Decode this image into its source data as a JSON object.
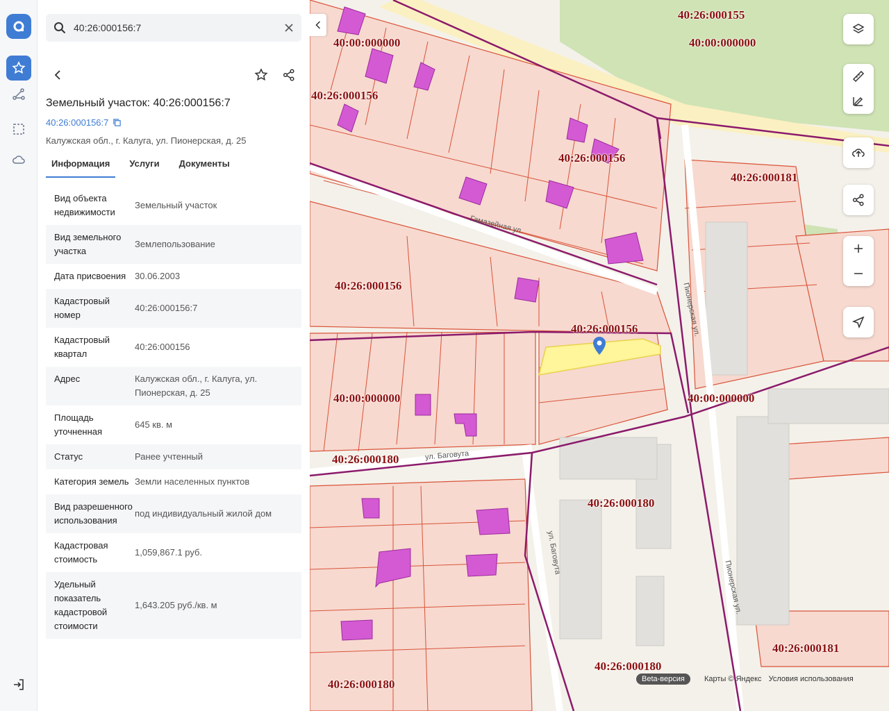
{
  "search": {
    "value": "40:26:000156:7"
  },
  "object": {
    "title": "Земельный участок: 40:26:000156:7",
    "cad_link": "40:26:000156:7",
    "address": "Калужская обл., г. Калуга, ул. Пионерская, д. 25"
  },
  "tabs": [
    "Информация",
    "Услуги",
    "Документы"
  ],
  "info": [
    {
      "k": "Вид объекта недвижимости",
      "v": "Земельный участок"
    },
    {
      "k": "Вид земельного участка",
      "v": "Землепользование"
    },
    {
      "k": "Дата присвоения",
      "v": "30.06.2003"
    },
    {
      "k": "Кадастровый номер",
      "v": "40:26:000156:7"
    },
    {
      "k": "Кадастровый квартал",
      "v": "40:26:000156"
    },
    {
      "k": "Адрес",
      "v": "Калужская обл., г. Калуга, ул. Пионерская, д. 25"
    },
    {
      "k": "Площадь уточненная",
      "v": "645 кв. м"
    },
    {
      "k": "Статус",
      "v": "Ранее учтенный"
    },
    {
      "k": "Категория земель",
      "v": "Земли населенных пунктов"
    },
    {
      "k": "Вид разрешенного использования",
      "v": "под индивидуальный жилой дом"
    },
    {
      "k": "Кадастровая стоимость",
      "v": "1,059,867.1 руб."
    },
    {
      "k": "Удельный показатель кадастровой стоимости",
      "v": "1,643.205 руб./кв. м"
    }
  ],
  "map": {
    "quarter_labels": [
      "40:26:000155",
      "40:00:000000",
      "40:00:000000",
      "40:26:000156",
      "40:26:000156",
      "40:26:000181",
      "40:26:000156",
      "40:26:000156",
      "40:00:000000",
      "40:00:000000",
      "40:26:000180",
      "40:26:000180",
      "40:26:000180",
      "40:26:000181",
      "40:26:000180"
    ],
    "streets": [
      "Гамазейная ул.",
      "Пионерская ул.",
      "ул. Баговута",
      "ул. Баговута",
      "Пионерская ул."
    ],
    "beta_label": "Beta-версия",
    "attribution": [
      "Карты © Яндекс",
      "Условия использования"
    ]
  },
  "colors": {
    "accent": "#3f7cd4",
    "parcel_stroke": "#d9533a",
    "parcel_fill": "#f7d9cf",
    "quarter_border": "#8b1a6b",
    "building": "#d45ad4",
    "selected": "#fff59a"
  }
}
